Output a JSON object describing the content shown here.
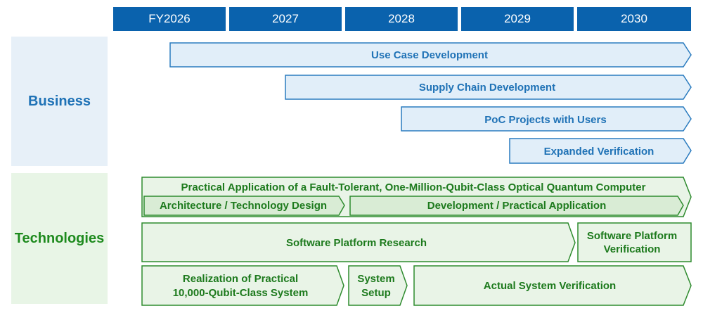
{
  "years": [
    "FY2026",
    "2027",
    "2028",
    "2029",
    "2030"
  ],
  "categories": {
    "business": "Business",
    "technologies": "Technologies"
  },
  "business_bars": [
    {
      "label": "Use Case Development"
    },
    {
      "label": "Supply Chain Development"
    },
    {
      "label": "PoC Projects with Users"
    },
    {
      "label": "Expanded Verification"
    }
  ],
  "tech": {
    "outer_title": "Practical Application of a Fault-Tolerant, One-Million-Qubit-Class Optical Quantum Computer",
    "arch_design": "Architecture / Technology Design",
    "development": "Development / Practical Application",
    "sw_research": "Software Platform Research",
    "sw_verification": [
      "Software Platform",
      "Verification"
    ],
    "realization": [
      "Realization of Practical",
      "10,000-Qubit-Class System"
    ],
    "system_setup": [
      "System",
      "Setup"
    ],
    "actual_verification": "Actual System Verification"
  },
  "colors": {
    "year_header": "#0a62ad",
    "business_fill": "#e1eef9",
    "business_stroke": "#2a7bbf",
    "tech_fill": "#e9f4e7",
    "tech_inner_fill": "#d9ecd5",
    "tech_stroke": "#2e8b2e"
  }
}
